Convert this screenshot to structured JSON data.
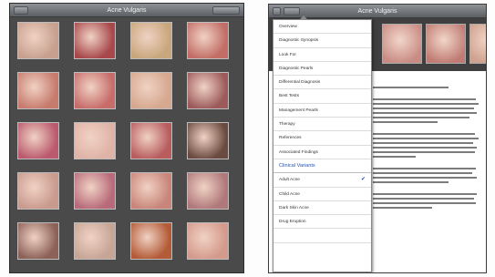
{
  "left_screen": {
    "title": "Acne Vulgaris",
    "back_button": "",
    "right_button": ""
  },
  "image_grid": [
    {
      "color": "#c7a08f"
    },
    {
      "color": "#a8484b"
    },
    {
      "color": "#c9a77d"
    },
    {
      "color": "#c26d66"
    },
    {
      "color": "#c77b6d"
    },
    {
      "color": "#c76c69"
    },
    {
      "color": "#d6a88f"
    },
    {
      "color": "#9c5a5a"
    },
    {
      "color": "#bb5a6e"
    },
    {
      "color": "#e0b3a7"
    },
    {
      "color": "#b85c5e"
    },
    {
      "color": "#6b4a3f"
    },
    {
      "color": "#c99a8e"
    },
    {
      "color": "#b86a7a"
    },
    {
      "color": "#c9857a"
    },
    {
      "color": "#b0787b"
    },
    {
      "color": "#8c6157"
    },
    {
      "color": "#c6a596"
    },
    {
      "color": "#b35a36"
    },
    {
      "color": "#d49a8c"
    }
  ],
  "right_screen": {
    "title": "Acne Vulgaris",
    "back_button": "",
    "left_button": "",
    "image_caption": "",
    "strip_colors": [
      "#c98c85",
      "#c07c74",
      "#cfa28e"
    ],
    "menu": [
      {
        "label": "Overview",
        "type": "item"
      },
      {
        "label": "Diagnostic Synopsis",
        "type": "item"
      },
      {
        "label": "Look For",
        "type": "item"
      },
      {
        "label": "Diagnostic Pearls",
        "type": "item"
      },
      {
        "label": "Differential Diagnosis",
        "type": "item"
      },
      {
        "label": "Best Tests",
        "type": "item"
      },
      {
        "label": "Management Pearls",
        "type": "item"
      },
      {
        "label": "Therapy",
        "type": "item"
      },
      {
        "label": "References",
        "type": "item"
      },
      {
        "label": "Associated Findings",
        "type": "item"
      },
      {
        "label": "Clinical Variants",
        "type": "section"
      },
      {
        "label": "Adult Acne",
        "type": "item",
        "checked": true
      },
      {
        "label": "Child Acne",
        "type": "item"
      },
      {
        "label": "Dark Skin Acne",
        "type": "item"
      },
      {
        "label": "Drug Eruption",
        "type": "item"
      },
      {
        "label": "",
        "type": "item"
      }
    ]
  }
}
